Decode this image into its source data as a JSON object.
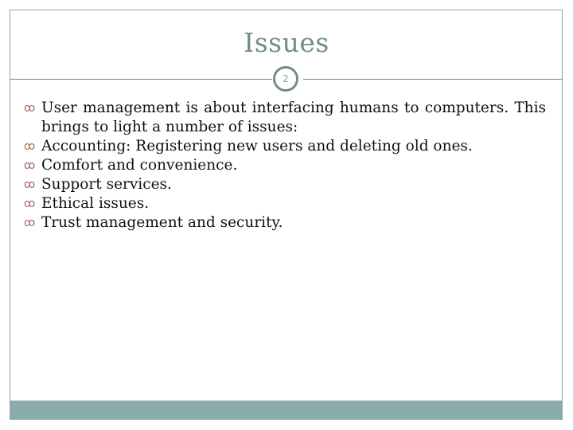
{
  "slide": {
    "title": "Issues",
    "number": "2",
    "bullet_icon": "curly-bullet-icon",
    "bullets": [
      {
        "text": "User management is about interfacing humans to computers. This brings to light a number of issues:"
      },
      {
        "text": "Accounting: Registering new users and deleting old ones."
      },
      {
        "text": "Comfort and convenience."
      },
      {
        "text": "Support services."
      },
      {
        "text": "Ethical issues."
      },
      {
        "text": "Trust management and security."
      }
    ],
    "colors": {
      "title": "#728c8a",
      "accent_bar": "#8aabaa",
      "bullet": "#a86a5c"
    }
  }
}
